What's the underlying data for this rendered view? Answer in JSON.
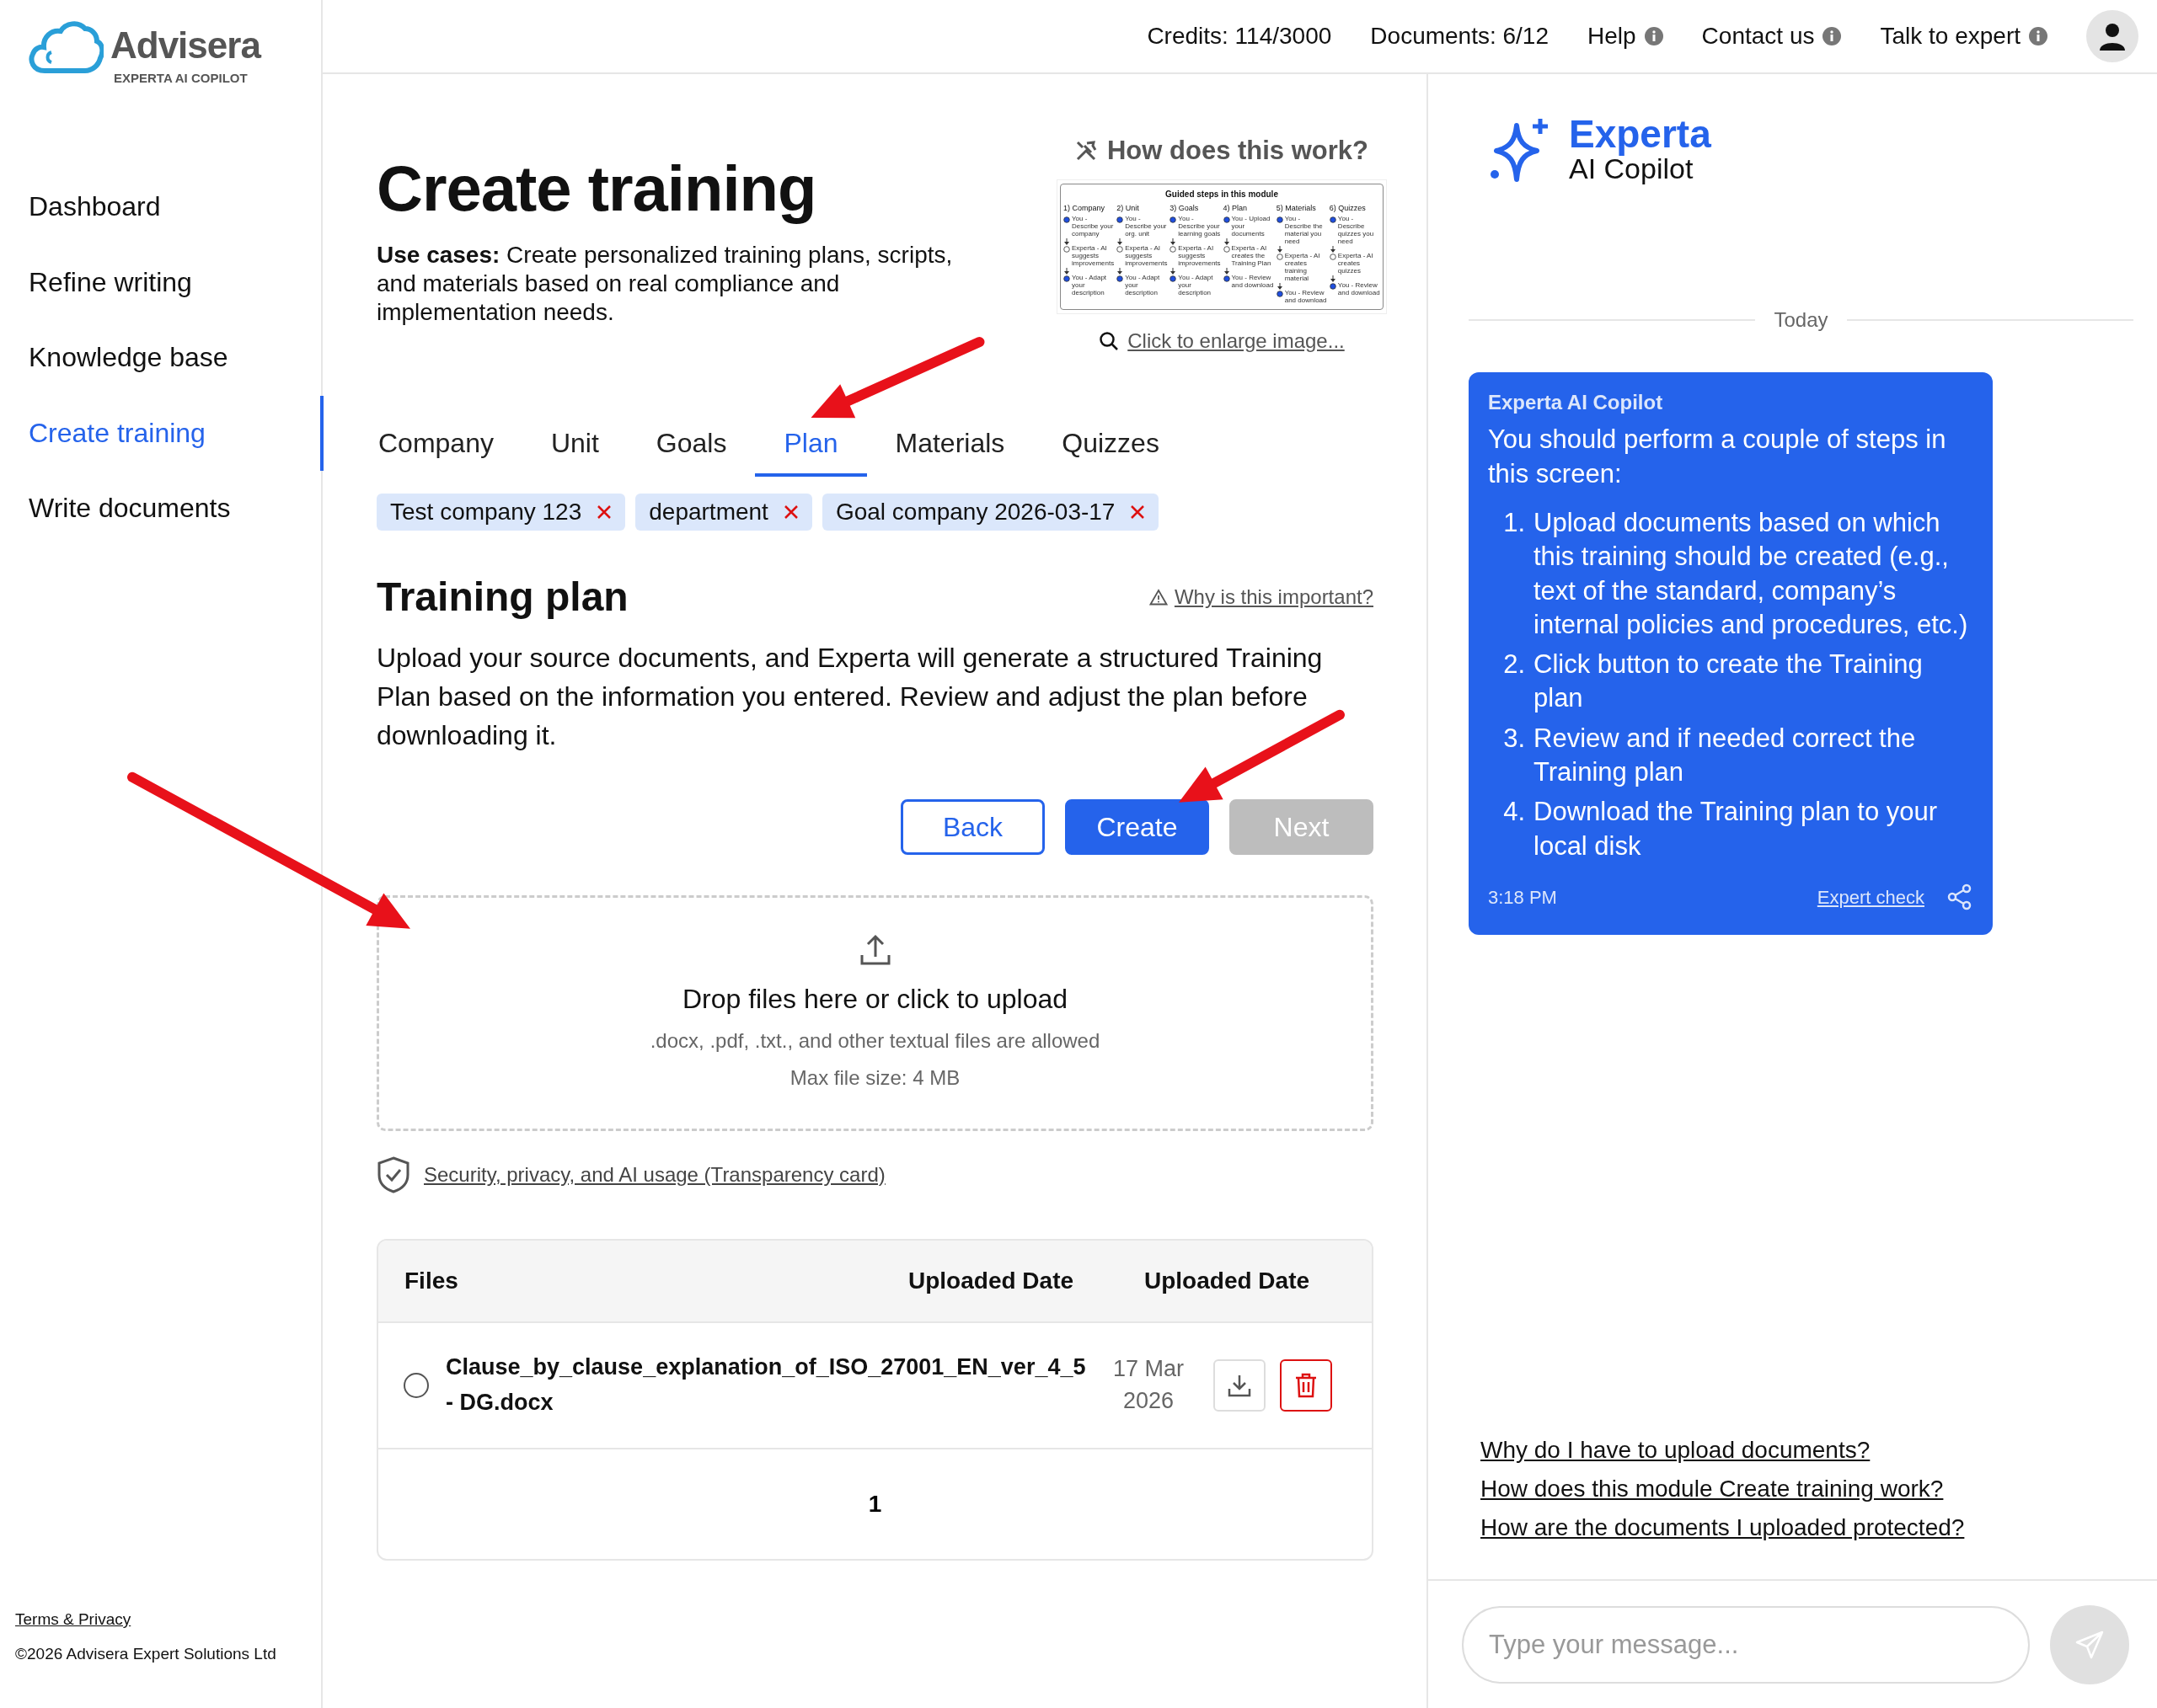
{
  "header": {
    "logo": {
      "name": "Advisera",
      "tagline": "EXPERTA AI COPILOT"
    },
    "stats": [
      "Credits: 114/3000",
      "Documents: 6/12"
    ],
    "links": [
      {
        "label": "Help"
      },
      {
        "label": "Contact us"
      },
      {
        "label": "Talk to expert"
      }
    ]
  },
  "sidebar": {
    "items": [
      {
        "label": "Dashboard",
        "selected": false
      },
      {
        "label": "Refine writing",
        "selected": false
      },
      {
        "label": "Knowledge base",
        "selected": false
      },
      {
        "label": "Create training",
        "selected": true
      },
      {
        "label": "Write documents",
        "selected": false
      }
    ],
    "footer": {
      "link": "Terms & Privacy",
      "copyright": "©2026 Advisera Expert Solutions Ltd"
    }
  },
  "main": {
    "title": "Create training",
    "use_cases": "**Use cases:** Create personalized training plans, scripts, and materials based on real compliance and implementation needs.",
    "how_it_works": {
      "heading": "How does this work?",
      "thumbnail": {
        "title": "Guided steps in this module",
        "steps": [
          {
            "label": "1) Company",
            "notes": [
              {
                "text": "You - Describe your company",
                "kind": "user"
              },
              {
                "text": "Experta - AI suggests improvements",
                "kind": "ai"
              },
              {
                "text": "You - Adapt your description",
                "kind": "user"
              }
            ]
          },
          {
            "label": "2) Unit",
            "notes": [
              {
                "text": "You - Describe your org. unit",
                "kind": "user"
              },
              {
                "text": "Experta - AI suggests improvements",
                "kind": "ai"
              },
              {
                "text": "You - Adapt your description",
                "kind": "user"
              }
            ]
          },
          {
            "label": "3) Goals",
            "notes": [
              {
                "text": "You - Describe your learning goals",
                "kind": "user"
              },
              {
                "text": "Experta - AI suggests improvements",
                "kind": "ai"
              },
              {
                "text": "You - Adapt your description",
                "kind": "user"
              }
            ]
          },
          {
            "label": "4) Plan",
            "notes": [
              {
                "text": "You - Upload your documents",
                "kind": "user"
              },
              {
                "text": "Experta - AI creates the Training Plan",
                "kind": "ai"
              },
              {
                "text": "You - Review and download",
                "kind": "user"
              }
            ]
          },
          {
            "label": "5) Materials",
            "notes": [
              {
                "text": "You - Describe the material you need",
                "kind": "user"
              },
              {
                "text": "Experta - AI creates training material",
                "kind": "ai"
              },
              {
                "text": "You - Review and download",
                "kind": "user"
              }
            ]
          },
          {
            "label": "6) Quizzes",
            "notes": [
              {
                "text": "You - Describe quizzes you need",
                "kind": "user"
              },
              {
                "text": "Experta - AI creates quizzes",
                "kind": "ai"
              },
              {
                "text": "You - Review and download",
                "kind": "user"
              }
            ]
          }
        ]
      },
      "enlarge_link": "Click to enlarge image..."
    },
    "tabs": [
      {
        "label": "Company",
        "selected": false
      },
      {
        "label": "Unit",
        "selected": false
      },
      {
        "label": "Goals",
        "selected": false
      },
      {
        "label": "Plan",
        "selected": true
      },
      {
        "label": "Materials",
        "selected": false
      },
      {
        "label": "Quizzes",
        "selected": false
      }
    ],
    "tags": [
      "Test company 123",
      "department",
      "Goal company 2026-03-17"
    ],
    "section": {
      "title": "Training plan",
      "why_link": "Why is this important?",
      "description": "Upload your source documents, and Experta will generate a structured Training Plan based on the information you entered. Review and adjust the plan before downloading it."
    },
    "buttons": [
      {
        "label": "Back",
        "kind": "outline",
        "disabled": false
      },
      {
        "label": "Create",
        "kind": "primary",
        "disabled": false
      },
      {
        "label": "Next",
        "kind": "primary",
        "disabled": true
      }
    ],
    "dropzone": {
      "title": "Drop files here or click to upload",
      "hint": ".docx, .pdf, .txt., and other textual files are allowed",
      "max_size": "Max file size: 4 MB"
    },
    "security_link": "Security, privacy, and AI usage (Transparency card)",
    "files_table": {
      "columns": [
        "Files",
        "Uploaded Date",
        "Uploaded Date"
      ],
      "rows": [
        {
          "name": "Clause_by_clause_explanation_of_ISO_27001_EN_ver_4_5 - DG.docx",
          "date": "17 Mar 2026",
          "selected": false
        }
      ],
      "pages": [
        {
          "label": "1",
          "selected": true
        }
      ]
    }
  },
  "assistant": {
    "brand": "Experta",
    "subtitle": "AI Copilot",
    "date_divider": "Today",
    "messages": [
      {
        "sender": "Experta AI Copilot",
        "intro": "You should perform a couple of steps in this screen:",
        "steps": [
          {
            "marker": "1.",
            "text": "Upload documents based on which this training should be created (e.g., text of the standard, company’s internal policies and procedures, etc.)"
          },
          {
            "marker": "2.",
            "text": "Click button to create the Training plan"
          },
          {
            "marker": "3.",
            "text": "Review and if needed correct the Training plan"
          },
          {
            "marker": "4.",
            "text": "Download the Training plan to your local disk"
          }
        ],
        "time": "3:18 PM",
        "action": "Expert check"
      }
    ],
    "suggestions": [
      "Why do I have to upload documents?",
      "How does this module Create training work?",
      "How are the documents I uploaded protected?"
    ],
    "composer": {
      "placeholder": "Type your message..."
    }
  }
}
